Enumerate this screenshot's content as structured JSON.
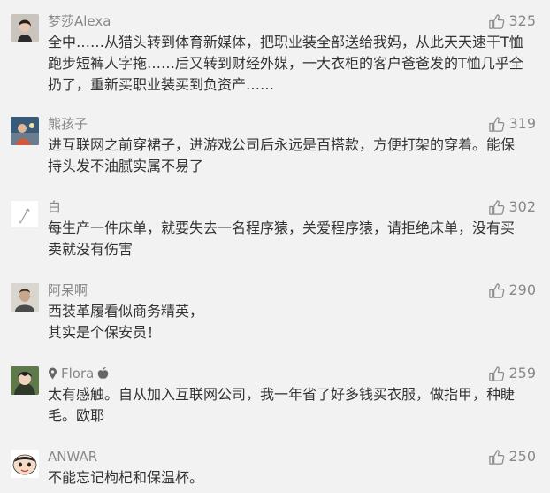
{
  "comments": [
    {
      "name": "梦莎Alexa",
      "likes": "325",
      "avatar_icon": "woman-portrait-avatar",
      "text": "全中……从猎头转到体育新媒体，把职业装全部送给我妈，从此天天速干T恤\n跑步短裤人字拖……后又转到财经外媒，一大衣柜的客户爸爸发的T恤几乎全\n扔了，重新买职业装买到负资产……"
    },
    {
      "name": "熊孩子",
      "likes": "319",
      "avatar_icon": "child-photo-avatar",
      "text": "进互联网之前穿裙子，进游戏公司后永远是百搭款，方便打架的穿着。能保\n持头发不油腻实属不易了"
    },
    {
      "name": "白",
      "likes": "302",
      "avatar_icon": "white-sketch-avatar",
      "text": "每生产一件床单，就要失去一名程序猿，关爱程序猿，请拒绝床单，没有买\n卖就没有伤害"
    },
    {
      "name": "阿呆啊",
      "likes": "290",
      "avatar_icon": "person-photo-avatar",
      "text": "西装革履看似商务精英，\n其实是个保安员！"
    },
    {
      "name": "Flora",
      "likes": "259",
      "avatar_icon": "anime-avatar",
      "text": "太有感触。自从加入互联网公司，我一年省了好多钱买衣服，做指甲，种睫\n毛。欧耶"
    },
    {
      "name": "ANWAR",
      "likes": "250",
      "avatar_icon": "cartoon-boy-avatar",
      "text": "不能忘记枸杞和保温杯。"
    }
  ],
  "colors": {
    "background": "#f2f2f2",
    "meta": "#888888",
    "text": "#333333"
  }
}
